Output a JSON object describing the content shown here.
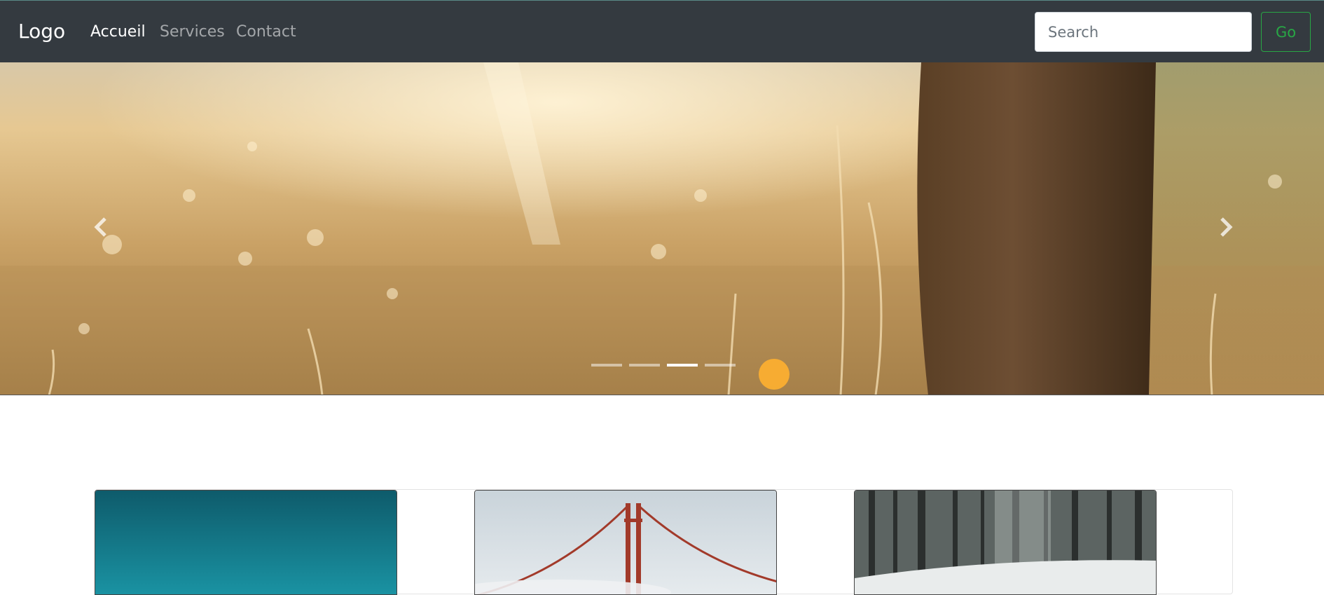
{
  "navbar": {
    "brand": "Logo",
    "links": [
      {
        "label": "Accueil",
        "active": true
      },
      {
        "label": "Services",
        "active": false
      },
      {
        "label": "Contact",
        "active": false
      }
    ],
    "search": {
      "placeholder": "Search",
      "value": ""
    },
    "go_label": "Go"
  },
  "carousel": {
    "slides": 4,
    "active_index": 2,
    "prev_icon": "chevron-left-icon",
    "next_icon": "chevron-right-icon"
  },
  "cards": [
    {
      "image": "teal-sky"
    },
    {
      "image": "golden-gate-bridge-fog"
    },
    {
      "image": "snowy-forest"
    }
  ],
  "colors": {
    "navbar_bg": "#343a40",
    "go_button": "#28a745"
  }
}
